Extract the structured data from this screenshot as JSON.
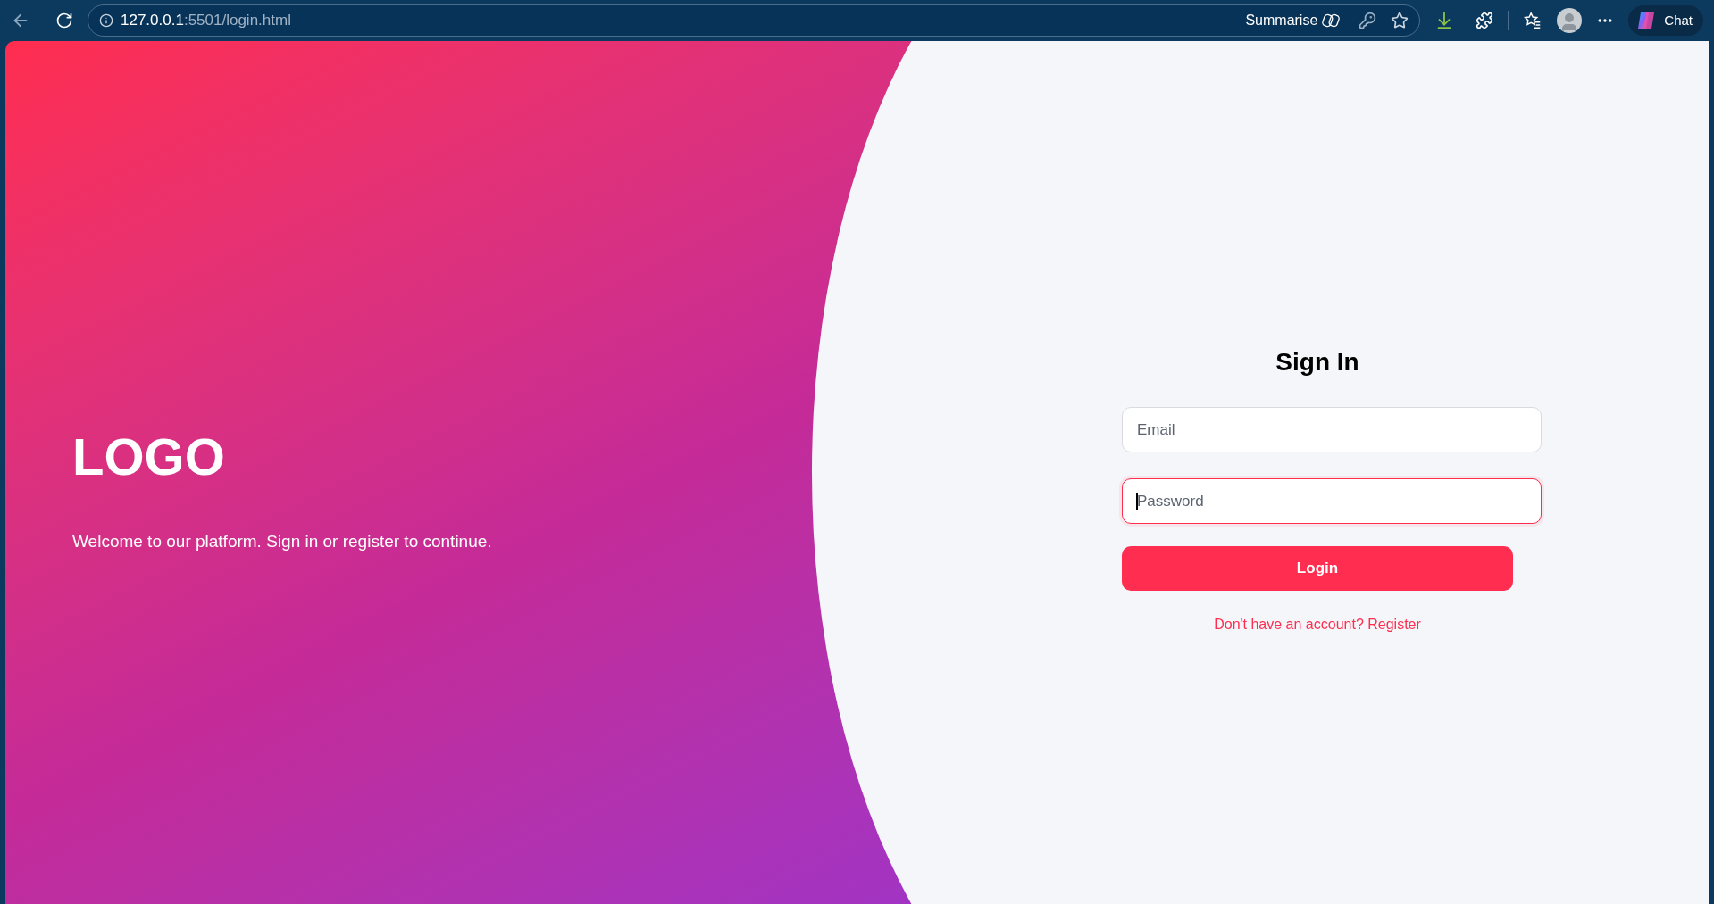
{
  "browser": {
    "url_host": "127.0.0.1",
    "url_path": ":5501/login.html",
    "summarise_label": "Summarise",
    "chat_label": "Chat"
  },
  "hero": {
    "logo": "LOGO",
    "tagline": "Welcome to our platform. Sign in or register to continue."
  },
  "form": {
    "title": "Sign In",
    "fields": [
      {
        "placeholder": "Email",
        "focused": false
      },
      {
        "placeholder": "Password",
        "focused": true
      }
    ],
    "submit": "Login",
    "register_link": "Don't have an account? Register"
  }
}
